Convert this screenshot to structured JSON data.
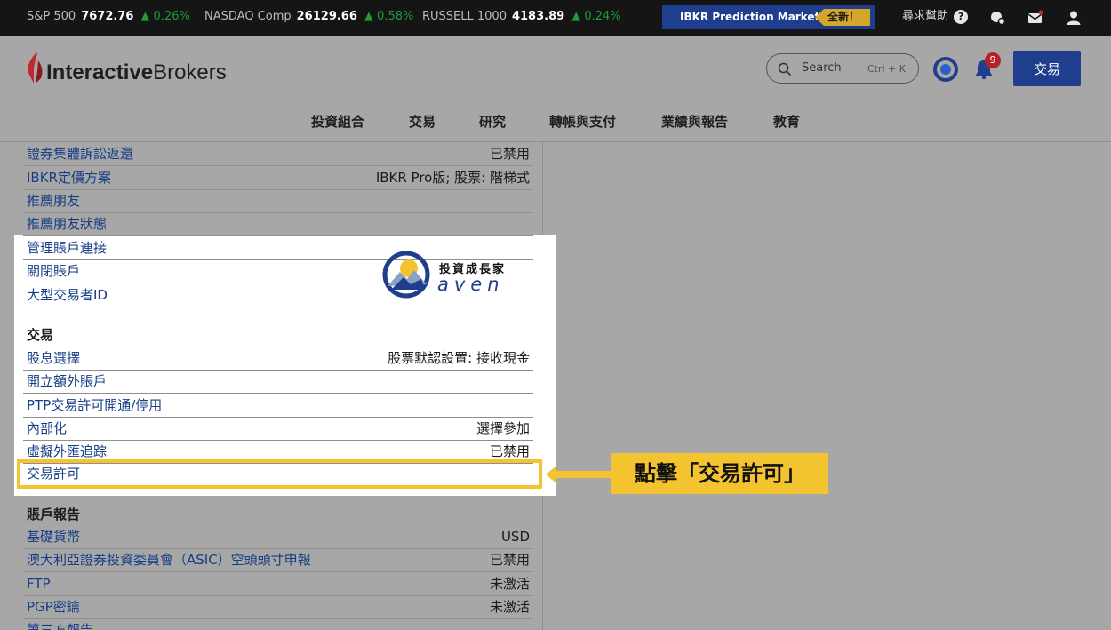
{
  "ticker": {
    "items": [
      {
        "name": "S&P 500",
        "value": "7672.76",
        "change": "▲ 0.26%"
      },
      {
        "name": "NASDAQ Comp",
        "value": "26129.66",
        "change": "▲ 0.58%"
      },
      {
        "name": "RUSSELL 1000",
        "value": "4183.89",
        "change": "▲ 0.24%"
      }
    ],
    "prediction_markets": "IBKR Prediction Markets",
    "new_badge": "全新！",
    "help": "尋求幫助",
    "help_icon": "?"
  },
  "header": {
    "logo_prefix": "Interactive",
    "logo_suffix": "Brokers",
    "search_label": "Search",
    "search_shortcut": "Ctrl + K",
    "notification_count": "9",
    "trade_button": "交易",
    "nav": [
      "投資組合",
      "交易",
      "研究",
      "轉帳與支付",
      "業績與報告",
      "教育"
    ]
  },
  "settings": {
    "top_rows": [
      {
        "label": "證券集體訴訟返還",
        "value": "已禁用"
      },
      {
        "label": "IBKR定價方案",
        "value": "IBKR Pro版; 股票: 階梯式"
      },
      {
        "label": "推薦朋友",
        "value": ""
      },
      {
        "label": "推薦朋友狀態",
        "value": ""
      },
      {
        "label": "管理賬戶連接",
        "value": ""
      },
      {
        "label": "關閉賬戶",
        "value": ""
      },
      {
        "label": "大型交易者ID",
        "value": ""
      }
    ],
    "trading_title": "交易",
    "trading_rows": [
      {
        "label": "股息選擇",
        "value": "股票默認設置: 接收現金"
      },
      {
        "label": "開立額外賬戶",
        "value": ""
      },
      {
        "label": "PTP交易許可開通/停用",
        "value": ""
      },
      {
        "label": "內部化",
        "value": "選擇參加"
      },
      {
        "label": "虛擬外匯追踪",
        "value": "已禁用"
      },
      {
        "label": "交易許可",
        "value": ""
      }
    ],
    "reports_title": "賬戶報告",
    "report_rows": [
      {
        "label": "基礎貨幣",
        "value": "USD"
      },
      {
        "label": "澳大利亞證券投資委員會（ASIC）空頭頭寸申報",
        "value": "已禁用"
      },
      {
        "label": "FTP",
        "value": "未激活"
      },
      {
        "label": "PGP密鑰",
        "value": "未激活"
      },
      {
        "label": "第三方報告",
        "value": ""
      }
    ]
  },
  "annotation": {
    "callout": "點擊「交易許可」",
    "color": "#f4c430"
  },
  "watermark": {
    "chinese": "投資成長家",
    "english": "aven"
  }
}
